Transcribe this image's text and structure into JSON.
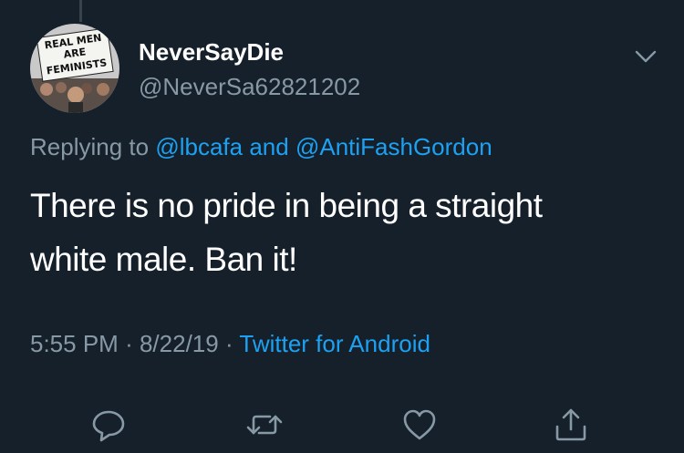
{
  "tweet": {
    "display_name": "NeverSayDie",
    "handle": "@NeverSa62821202",
    "avatar_sign_text": [
      "REAL MEN",
      "ARE",
      "FEMINISTS"
    ],
    "replying_prefix": "Replying to",
    "replying_mention_1": "@lbcafa",
    "replying_connector": "and",
    "replying_mention_2": "@AntiFashGordon",
    "text_line_1": "There is no pride in being a straight",
    "text_line_2": "white male. Ban it!",
    "time": "5:55 PM",
    "date": "8/22/19",
    "separator": "·",
    "source": "Twitter for Android"
  },
  "actions": [
    {
      "name": "reply",
      "icon": "reply-icon"
    },
    {
      "name": "retweet",
      "icon": "retweet-icon"
    },
    {
      "name": "like",
      "icon": "heart-icon"
    },
    {
      "name": "share",
      "icon": "share-icon"
    }
  ],
  "colors": {
    "background": "#15202b",
    "primary_text": "#ffffff",
    "secondary_text": "#8899a6",
    "link": "#1da1f2",
    "thread_line": "#38444d"
  }
}
